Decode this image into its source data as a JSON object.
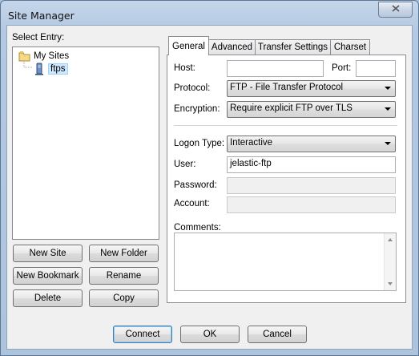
{
  "window": {
    "title": "Site Manager"
  },
  "left": {
    "select_entry_label": "Select Entry:",
    "tree": [
      {
        "label": "My Sites",
        "icon": "folder-icon"
      },
      {
        "label": "ftps",
        "icon": "server-icon",
        "selected": true
      }
    ],
    "buttons": {
      "new_site": "New Site",
      "new_folder": "New Folder",
      "new_bookmark": "New Bookmark",
      "rename": "Rename",
      "delete": "Delete",
      "copy": "Copy"
    }
  },
  "tabs": [
    "General",
    "Advanced",
    "Transfer Settings",
    "Charset"
  ],
  "active_tab": "General",
  "general": {
    "host_label": "Host:",
    "host_value": "",
    "port_label": "Port:",
    "port_value": "",
    "protocol_label": "Protocol:",
    "protocol_value": "FTP - File Transfer Protocol",
    "encryption_label": "Encryption:",
    "encryption_value": "Require explicit FTP over TLS",
    "logon_type_label": "Logon Type:",
    "logon_type_value": "Interactive",
    "user_label": "User:",
    "user_value": "jelastic-ftp",
    "password_label": "Password:",
    "password_value": "",
    "account_label": "Account:",
    "account_value": "",
    "comments_label": "Comments:",
    "comments_value": ""
  },
  "footer": {
    "connect": "Connect",
    "ok": "OK",
    "cancel": "Cancel"
  },
  "colors": {
    "title_bar": "#b3c8e1",
    "dialog_bg": "#f0f0f0",
    "selection": "#cde8ff"
  }
}
